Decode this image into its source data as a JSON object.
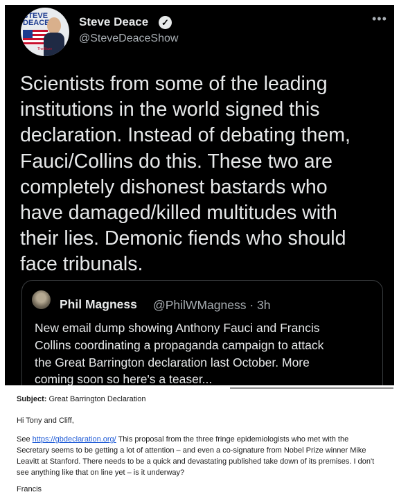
{
  "tweet": {
    "author_name": "Steve Deace",
    "author_handle": "@SteveDeaceShow",
    "avatar_logo": "STEVE\nDEACE",
    "avatar_tag": "TheBlaze",
    "more_icon": "more-dots-icon",
    "text": "Scientists from some of the leading\ninstitutions in the world signed this\ndeclaration. Instead of debating them,\nFauci/Collins do this. These two are\ncompletely dishonest bastards who\nhave damaged/killed multitudes with\ntheir lies. Demonic fiends who should\nface tribunals."
  },
  "quote": {
    "author_name": "Phil Magness",
    "author_handle": "@PhilWMagness · 3h",
    "text": "New email dump showing Anthony Fauci and Francis\nCollins coordinating a propaganda campaign to attack\nthe Great Barrington declaration last October. More\ncoming soon so here's a teaser..."
  },
  "email": {
    "subject_label": "Subject:",
    "subject_value": " Great Barrington Declaration",
    "greeting": "Hi Tony and Cliff,",
    "see_label": "See ",
    "link": "https://gbdeclaration.org/",
    "body": "  This proposal from the three fringe epidemiologists who met with the Secretary seems to be getting a lot of attention – and even a co-signature from Nobel Prize winner Mike Leavitt at Stanford.  There needs to be a quick and devastating published take down of its premises.  I don't see anything like that on line yet – is it underway?",
    "signature": "Francis"
  },
  "colors": {
    "tweet_bg": "#000000",
    "tweet_text": "#e7e9ea",
    "secondary_text": "#a8aeb3",
    "link": "#1f5bd6"
  }
}
